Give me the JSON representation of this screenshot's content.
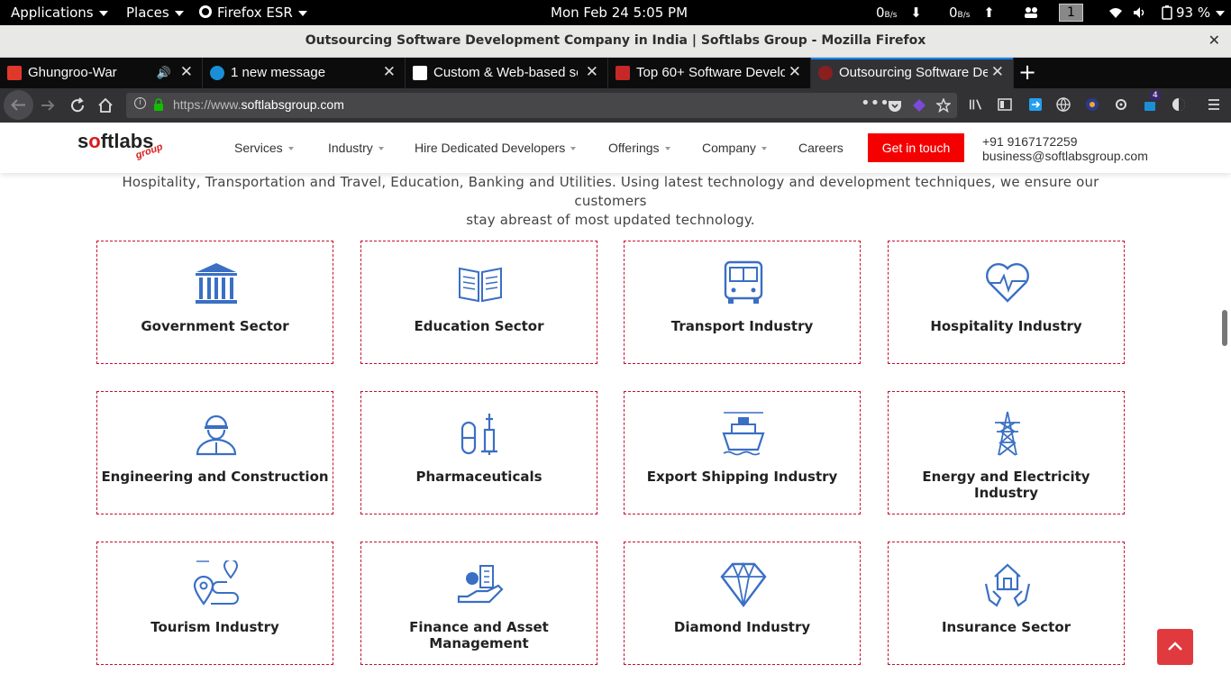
{
  "topbar": {
    "applications": "Applications",
    "places": "Places",
    "browser": "Firefox ESR",
    "datetime": "Mon Feb 24   5:05 PM",
    "net_down": "0",
    "net_down_unit": "B/s",
    "net_up": "0",
    "net_up_unit": "B/s",
    "workspace": "1",
    "battery": "93 %"
  },
  "window": {
    "title": "Outsourcing Software Development Company in India | Softlabs Group - Mozilla Firefox",
    "close": "✕"
  },
  "tabs": [
    {
      "label": "Ghungroo-War",
      "fav_color": "#e0392b",
      "fav_icon": "gaana-icon",
      "audio": true
    },
    {
      "label": "1 new message",
      "fav_color": "#1a8fd8",
      "fav_icon": "globe-icon"
    },
    {
      "label": "Custom & Web-based so",
      "fav_color": "#ffffff",
      "fav_icon": "google-icon"
    },
    {
      "label": "Top 60+ Software Develo",
      "fav_color": "#c62828",
      "fav_icon": "star-icon"
    },
    {
      "label": "Outsourcing Software De",
      "fav_color": "#8a1f1f",
      "fav_icon": "softlabs-icon",
      "active": true
    }
  ],
  "navbar": {
    "url_prefix": "https://www.",
    "url_domain": "softlabsgroup.com",
    "page_actions": "•••",
    "notif_count": "4"
  },
  "site": {
    "logo_text_s": "s",
    "logo_text_o": "o",
    "logo_text_rest": "ftlabs",
    "logo_group": "group",
    "menu": [
      {
        "label": "Services",
        "caret": true
      },
      {
        "label": "Industry",
        "caret": true
      },
      {
        "label": "Hire Dedicated Developers",
        "caret": true
      },
      {
        "label": "Offerings",
        "caret": true
      },
      {
        "label": "Company",
        "caret": true
      },
      {
        "label": "Careers",
        "caret": false
      }
    ],
    "cta": "Get in touch",
    "phone": "+91 9167172259",
    "email": "business@softlabsgroup.com"
  },
  "content": {
    "intro_line1": "Hospitality, Transportation and Travel, Education, Banking and Utilities. Using latest technology and development techniques, we ensure our customers",
    "intro_line2": "stay abreast of most updated technology.",
    "accent": "#3a6fc4",
    "border_color": "#c8102e",
    "industries": [
      {
        "name": "Government Sector",
        "icon": "government-building-icon"
      },
      {
        "name": "Education Sector",
        "icon": "open-book-icon"
      },
      {
        "name": "Transport Industry",
        "icon": "bus-icon"
      },
      {
        "name": "Hospitality Industry",
        "icon": "heart-pulse-icon"
      },
      {
        "name": "Engineering and Construction",
        "icon": "engineer-icon"
      },
      {
        "name": "Pharmaceuticals",
        "icon": "pill-syringe-icon"
      },
      {
        "name": "Export Shipping Industry",
        "icon": "ship-icon"
      },
      {
        "name": "Energy and Electricity Industry",
        "icon": "power-tower-icon"
      },
      {
        "name": "Tourism Industry",
        "icon": "map-pin-route-icon"
      },
      {
        "name": "Finance and Asset Management",
        "icon": "money-hand-icon"
      },
      {
        "name": "Diamond Industry",
        "icon": "diamond-icon"
      },
      {
        "name": "Insurance Sector",
        "icon": "house-hands-icon"
      }
    ]
  }
}
